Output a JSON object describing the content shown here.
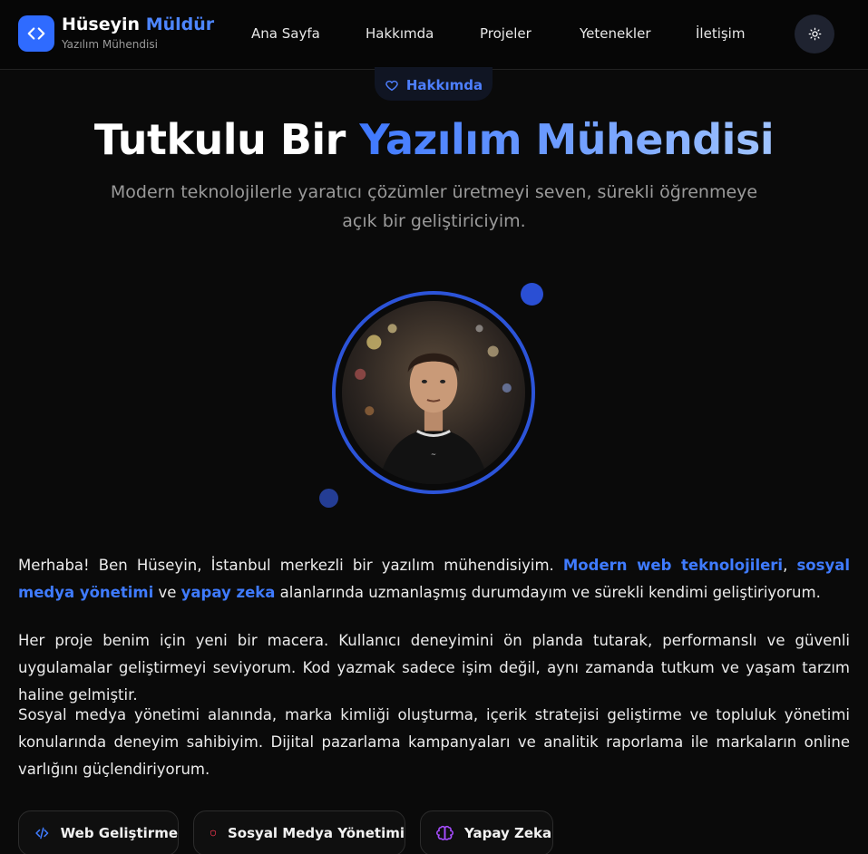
{
  "brand": {
    "first_name": "Hüseyin",
    "last_name": "Müldür",
    "subtitle": "Yazılım Mühendisi",
    "logo_icon": "code-icon"
  },
  "nav": {
    "items": [
      {
        "label": "Ana Sayfa"
      },
      {
        "label": "Hakkımda"
      },
      {
        "label": "Projeler"
      },
      {
        "label": "Yetenekler"
      },
      {
        "label": "İletişim"
      }
    ],
    "theme_toggle_icon": "sun-icon"
  },
  "section": {
    "pill_label": "Hakkımda",
    "pill_icon": "heart-icon",
    "title_plain": "Tutkulu Bir",
    "title_highlight": "Yazılım Mühendisi",
    "subtitle": "Modern teknolojilerle yaratıcı çözümler üretmeyi seven, sürekli öğrenmeye açık bir geliştiriciyim."
  },
  "about": {
    "p1": {
      "a": "Merhaba! Ben Hüseyin, İstanbul merkezli bir yazılım mühendisiyim. ",
      "h1": "Modern web teknolojileri",
      "b": ", ",
      "h2": "sosyal medya yönetimi",
      "c": " ve ",
      "h3": "yapay zeka",
      "d": " alanlarında uzmanlaşmış durumdayım ve sürekli kendimi geliştiriyorum."
    },
    "p2": "Her proje benim için yeni bir macera. Kullanıcı deneyimini ön planda tutarak, performanslı ve güvenli uygulamalar geliştirmeyi seviyorum. Kod yazmak sadece işim değil, aynı zamanda tutkum ve yaşam tarzım haline gelmiştir.",
    "p3": "Sosyal medya yönetimi alanında, marka kimliği oluşturma, içerik stratejisi geliştirme ve topluluk yönetimi konularında deneyim sahibiyim. Dijital pazarlama kampanyaları ve analitik raporlama ile markaların online varlığını güçlendiriyorum."
  },
  "skills": [
    {
      "label": "Web Geliştirme",
      "icon": "code-icon",
      "color": "#3f7bff"
    },
    {
      "label": "Sosyal Medya Yönetimi",
      "icon": "shield-icon",
      "color": "#e0334a"
    },
    {
      "label": "Yapay Zeka",
      "icon": "brain-icon",
      "color": "#a64dff"
    }
  ],
  "colors": {
    "accent": "#2f6bff",
    "background": "#0a0a0a"
  }
}
